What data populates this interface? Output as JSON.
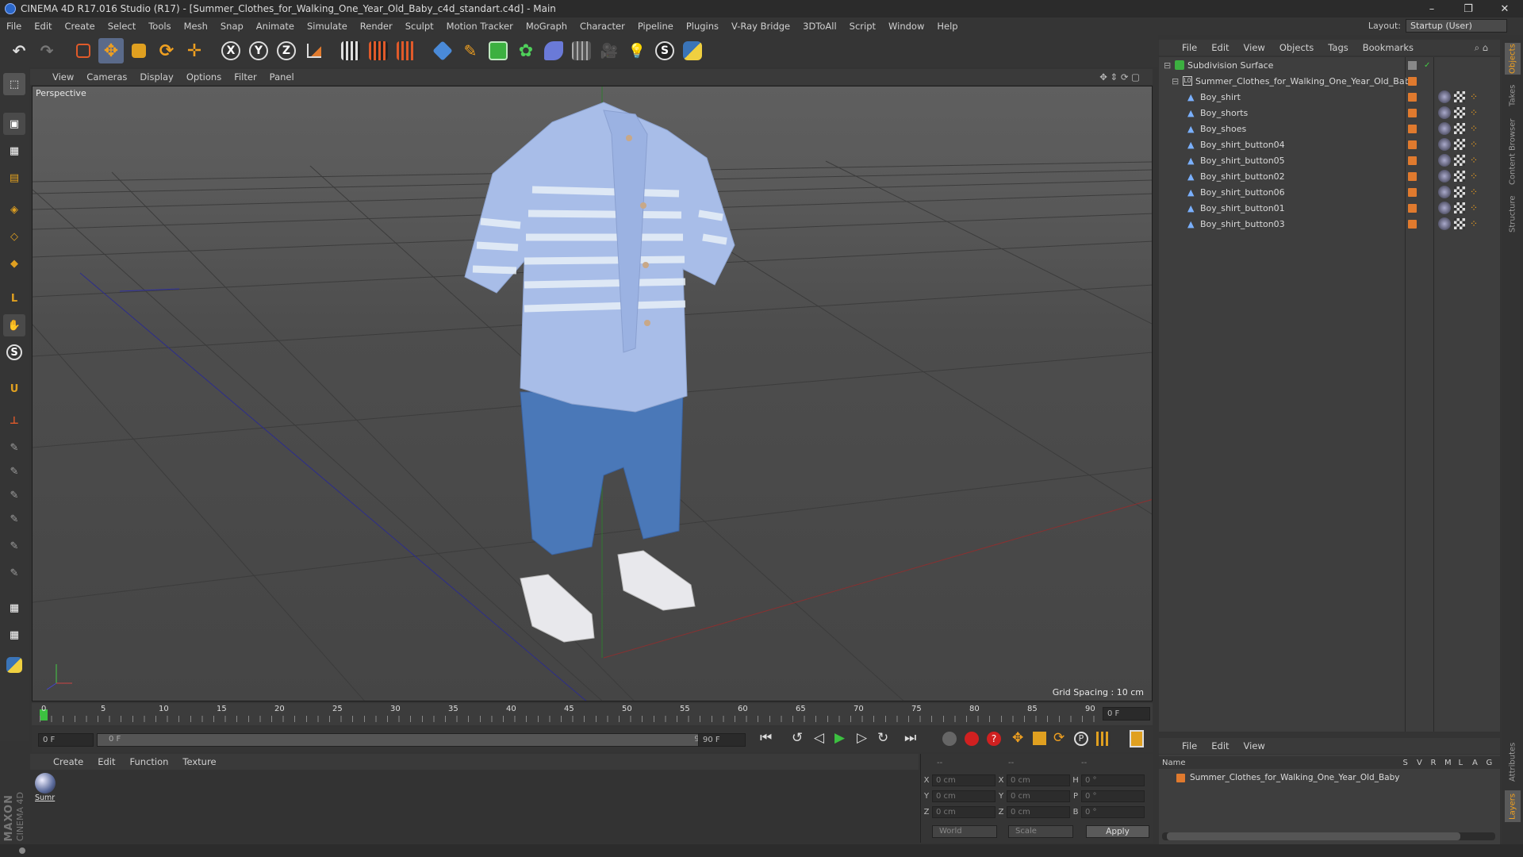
{
  "app": {
    "title": "CINEMA 4D R17.016 Studio (R17) - [Summer_Clothes_for_Walking_One_Year_Old_Baby_c4d_standart.c4d] - Main",
    "window_buttons": [
      "–",
      "❐",
      "✕"
    ]
  },
  "menu": [
    "File",
    "Edit",
    "Create",
    "Select",
    "Tools",
    "Mesh",
    "Snap",
    "Animate",
    "Simulate",
    "Render",
    "Sculpt",
    "Motion Tracker",
    "MoGraph",
    "Character",
    "Pipeline",
    "Plugins",
    "V-Ray Bridge",
    "3DToAll",
    "Script",
    "Window",
    "Help"
  ],
  "layout": {
    "label": "Layout:",
    "value": "Startup (User)"
  },
  "toolbar_axes": [
    "X",
    "Y",
    "Z"
  ],
  "viewport": {
    "menu": [
      "View",
      "Cameras",
      "Display",
      "Options",
      "Filter",
      "Panel"
    ],
    "label": "Perspective",
    "grid_spacing": "Grid Spacing : 10 cm"
  },
  "timeline": {
    "ticks": [
      "0",
      "5",
      "10",
      "15",
      "20",
      "25",
      "30",
      "35",
      "40",
      "45",
      "50",
      "55",
      "60",
      "65",
      "70",
      "75",
      "80",
      "85",
      "90"
    ],
    "current_frame": "0 F",
    "start_field": "0 F",
    "range_start": "0 F",
    "range_end": "90 F",
    "end_field": "90 F"
  },
  "materials": {
    "menu": [
      "Create",
      "Edit",
      "Function",
      "Texture"
    ],
    "items": [
      {
        "name": "Sumr"
      }
    ]
  },
  "coords": {
    "header": [
      "--",
      "--",
      "--"
    ],
    "rows": [
      {
        "a": "X",
        "av": "0 cm",
        "b": "X",
        "bv": "0 cm",
        "c": "H",
        "cv": "0 °"
      },
      {
        "a": "Y",
        "av": "0 cm",
        "b": "Y",
        "bv": "0 cm",
        "c": "P",
        "cv": "0 °"
      },
      {
        "a": "Z",
        "av": "0 cm",
        "b": "Z",
        "bv": "0 cm",
        "c": "B",
        "cv": "0 °"
      }
    ],
    "world": "World",
    "scale": "Scale",
    "apply": "Apply"
  },
  "objects": {
    "menu": [
      "File",
      "Edit",
      "View",
      "Objects",
      "Tags",
      "Bookmarks"
    ],
    "tree": [
      {
        "name": "Subdivision Surface",
        "level": 0
      },
      {
        "name": "Summer_Clothes_for_Walking_One_Year_Old_Baby",
        "level": 1
      },
      {
        "name": "Boy_shirt",
        "level": 2
      },
      {
        "name": "Boy_shorts",
        "level": 2
      },
      {
        "name": "Boy_shoes",
        "level": 2
      },
      {
        "name": "Boy_shirt_button04",
        "level": 2
      },
      {
        "name": "Boy_shirt_button05",
        "level": 2
      },
      {
        "name": "Boy_shirt_button02",
        "level": 2
      },
      {
        "name": "Boy_shirt_button06",
        "level": 2
      },
      {
        "name": "Boy_shirt_button01",
        "level": 2
      },
      {
        "name": "Boy_shirt_button03",
        "level": 2
      }
    ]
  },
  "right_tabs": [
    "Objects",
    "Takes",
    "Content Browser",
    "Structure",
    "Attributes",
    "Layers"
  ],
  "layers": {
    "menu": [
      "File",
      "Edit",
      "View"
    ],
    "columns": [
      "Name",
      "S",
      "V",
      "R",
      "M",
      "L",
      "A",
      "G"
    ],
    "row": "Summer_Clothes_for_Walking_One_Year_Old_Baby"
  },
  "brand": [
    "MAXON",
    "CINEMA 4D"
  ]
}
